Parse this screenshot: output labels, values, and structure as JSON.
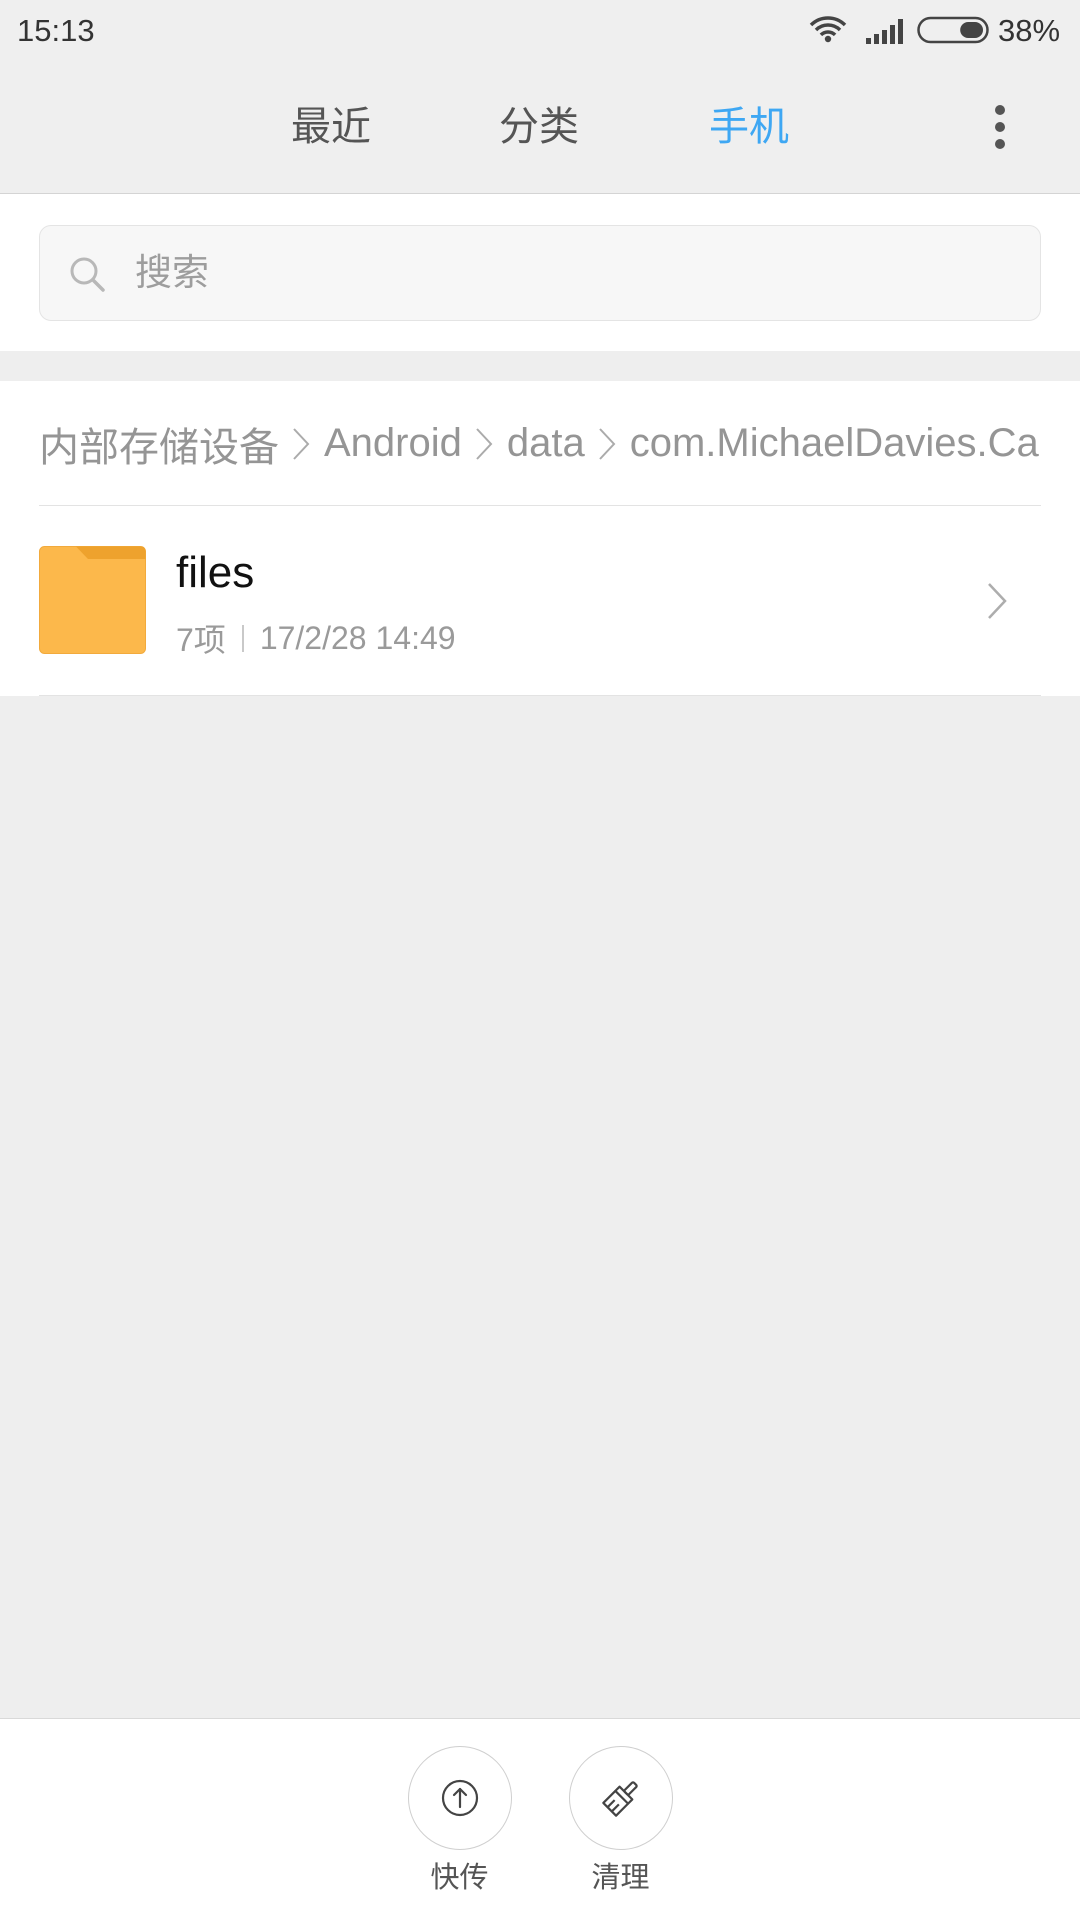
{
  "status_bar": {
    "time": "15:13",
    "battery_text": "38%",
    "battery_level": 38,
    "icons": {
      "wifi": "wifi-icon",
      "signal": "signal-icon",
      "battery": "battery-icon"
    }
  },
  "nav": {
    "tabs": [
      {
        "label": "最近",
        "active": false
      },
      {
        "label": "分类",
        "active": false
      },
      {
        "label": "手机",
        "active": true
      }
    ],
    "more_icon": "more-vert-icon"
  },
  "search": {
    "placeholder": "搜索",
    "value": "",
    "icon": "search-icon"
  },
  "breadcrumb": {
    "items": [
      "内部存储设备",
      "Android",
      "data",
      "com.MichaelDavies.Ca"
    ],
    "separator_icon": "chevron-right-icon"
  },
  "file_list": [
    {
      "name": "files",
      "icon": "folder-icon",
      "item_count": "7项",
      "modified": "17/2/28 14:49",
      "chevron_icon": "chevron-right-icon"
    }
  ],
  "bottom_actions": [
    {
      "label": "快传",
      "icon": "upload-icon"
    },
    {
      "label": "清理",
      "icon": "broom-icon"
    }
  ],
  "colors": {
    "accent": "#3ea7f3",
    "folder": "#fcb84b",
    "folder_tab": "#eea22d",
    "background": "#eeeeee"
  }
}
